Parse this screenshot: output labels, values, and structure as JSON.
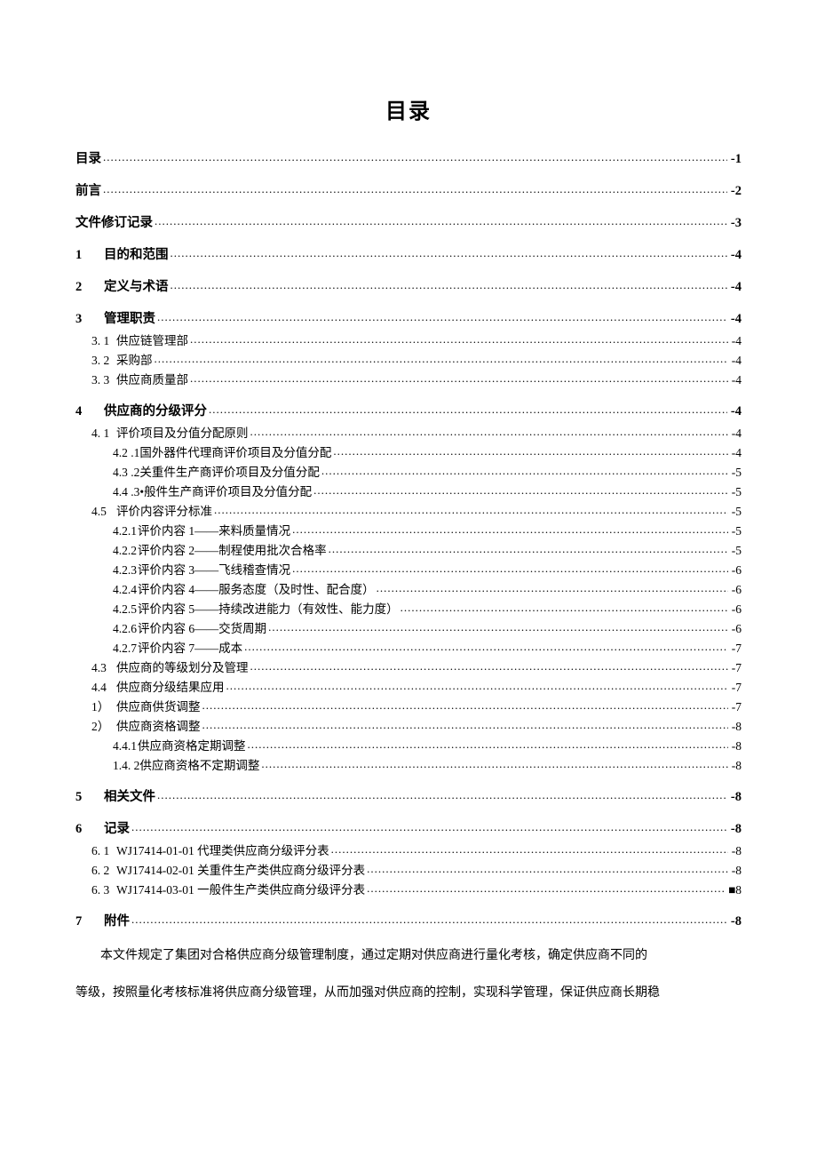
{
  "title": "目录",
  "toc": [
    {
      "level": 0,
      "num": "",
      "label": "目录",
      "page": "-1"
    },
    {
      "level": 0,
      "num": "",
      "label": "前言",
      "page": "-2"
    },
    {
      "level": 0,
      "num": "",
      "label": "文件修订记录",
      "page": "-3"
    },
    {
      "level": 0,
      "num": "1",
      "label": "目的和范围",
      "page": "-4"
    },
    {
      "level": 0,
      "num": "2",
      "label": "定义与术语",
      "page": "-4"
    },
    {
      "level": 0,
      "num": "3",
      "label": "管理职责",
      "page": "-4"
    },
    {
      "level": 1,
      "num": "3. 1",
      "label": "供应链管理部",
      "page": "-4"
    },
    {
      "level": 1,
      "num": "3. 2",
      "label": "采购部",
      "page": "-4"
    },
    {
      "level": 1,
      "num": "3. 3",
      "label": "供应商质量部",
      "page": "-4"
    },
    {
      "level": 0,
      "num": "4",
      "label": "供应商的分级评分",
      "page": "-4"
    },
    {
      "level": 1,
      "num": "4. 1",
      "label": "评价项目及分值分配原则",
      "page": "-4"
    },
    {
      "level": 2,
      "num": "4.2 .1",
      "label": "国外器件代理商评价项目及分值分配",
      "page": "-4"
    },
    {
      "level": 2,
      "num": "4.3 .2",
      "label": "关重件生产商评价项目及分值分配",
      "page": "-5"
    },
    {
      "level": 2,
      "num": "4.4 .3",
      "label": "•般件生产商评价项目及分值分配",
      "page": "-5"
    },
    {
      "level": 1,
      "num": "4.5",
      "label": "评价内容评分标准",
      "page": "-5"
    },
    {
      "level": 2,
      "num": "4.2.1",
      "label": "评价内容 1——来料质量情况",
      "page": "-5"
    },
    {
      "level": 2,
      "num": "4.2.2",
      "label": "评价内容 2——制程使用批次合格率",
      "page": "-5"
    },
    {
      "level": 2,
      "num": "4.2.3",
      "label": "评价内容 3——飞线稽查情况",
      "page": "-6"
    },
    {
      "level": 2,
      "num": "4.2.4",
      "label": "评价内容 4——服务态度（及时性、配合度）",
      "page": "-6"
    },
    {
      "level": 2,
      "num": "4.2.5",
      "label": "评价内容 5——持续改进能力（有效性、能力度）",
      "page": "-6"
    },
    {
      "level": 2,
      "num": "4.2.6",
      "label": "评价内容 6——交货周期",
      "page": "-6"
    },
    {
      "level": 2,
      "num": "4.2.7",
      "label": "评价内容 7——成本",
      "page": "-7"
    },
    {
      "level": 1,
      "num": "4.3",
      "label": "供应商的等级划分及管理",
      "page": "-7"
    },
    {
      "level": 1,
      "num": "4.4",
      "label": "供应商分级结果应用",
      "page": "-7"
    },
    {
      "level": 1,
      "num": "1）",
      "label": "供应商供货调整",
      "page": "-7"
    },
    {
      "level": 1,
      "num": "2）",
      "label": "供应商资格调整",
      "page": "-8"
    },
    {
      "level": 2,
      "num": "4.4.1",
      "label": "供应商资格定期调整",
      "page": "-8"
    },
    {
      "level": 2,
      "num": "1.4. 2",
      "label": "供应商资格不定期调整",
      "page": "-8"
    },
    {
      "level": 0,
      "num": "5",
      "label": "相关文件",
      "page": "-8"
    },
    {
      "level": 0,
      "num": "6",
      "label": "记录",
      "page": "-8"
    },
    {
      "level": 1,
      "num": "6. 1",
      "label": "WJ17414-01-01 代理类供应商分级评分表",
      "page": "-8"
    },
    {
      "level": 1,
      "num": "6. 2",
      "label": "WJ17414-02-01 关重件生产类供应商分级评分表",
      "page": "-8"
    },
    {
      "level": 1,
      "num": "6. 3",
      "label": "WJ17414-03-01 一般件生产类供应商分级评分表",
      "page": "■8"
    },
    {
      "level": 0,
      "num": "7",
      "label": "附件",
      "page": "-8"
    }
  ],
  "body": {
    "p1": "本文件规定了集团对合格供应商分级管理制度，通过定期对供应商进行量化考核，确定供应商不同的",
    "p2": "等级，按照量化考核标准将供应商分级管理，从而加强对供应商的控制，实现科学管理，保证供应商长期稳"
  }
}
